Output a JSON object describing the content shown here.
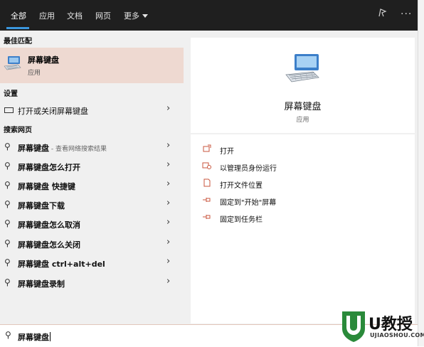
{
  "tabs": [
    {
      "label": "全部"
    },
    {
      "label": "应用"
    },
    {
      "label": "文档"
    },
    {
      "label": "网页"
    },
    {
      "label": "更多"
    }
  ],
  "top_icons": [
    "feedback-icon",
    "more-options-icon"
  ],
  "best_match": {
    "section": "最佳匹配",
    "name": "屏幕键盘",
    "type": "应用"
  },
  "settings": {
    "section": "设置",
    "item": "打开或关闭屏幕键盘"
  },
  "web": {
    "section": "搜索网页",
    "items": [
      {
        "label": "屏幕键盘",
        "suffix": " - 查看网络搜索结果"
      },
      {
        "label": "屏幕键盘怎么打开",
        "suffix": ""
      },
      {
        "label": "屏幕键盘 快捷键",
        "suffix": ""
      },
      {
        "label": "屏幕键盘下载",
        "suffix": ""
      },
      {
        "label": "屏幕键盘怎么取消",
        "suffix": ""
      },
      {
        "label": "屏幕键盘怎么关闭",
        "suffix": ""
      },
      {
        "label": "屏幕键盘 ctrl+alt+del",
        "suffix": ""
      },
      {
        "label": "屏幕键盘录制",
        "suffix": ""
      }
    ]
  },
  "detail": {
    "title": "屏幕键盘",
    "type": "应用",
    "actions": [
      {
        "label": "打开",
        "icon": "open-icon"
      },
      {
        "label": "以管理员身份运行",
        "icon": "run-as-admin-icon"
      },
      {
        "label": "打开文件位置",
        "icon": "file-location-icon"
      },
      {
        "label": "固定到\"开始\"屏幕",
        "icon": "pin-icon"
      },
      {
        "label": "固定到任务栏",
        "icon": "pin-icon"
      }
    ]
  },
  "search": {
    "value": "屏幕键盘"
  },
  "watermark": {
    "title": "U教授",
    "url": "UJIAOSHOU.COM"
  },
  "colors": {
    "accent": "#3a96dd",
    "selected": "#eed9d1",
    "topbar": "#1f1f1f"
  }
}
